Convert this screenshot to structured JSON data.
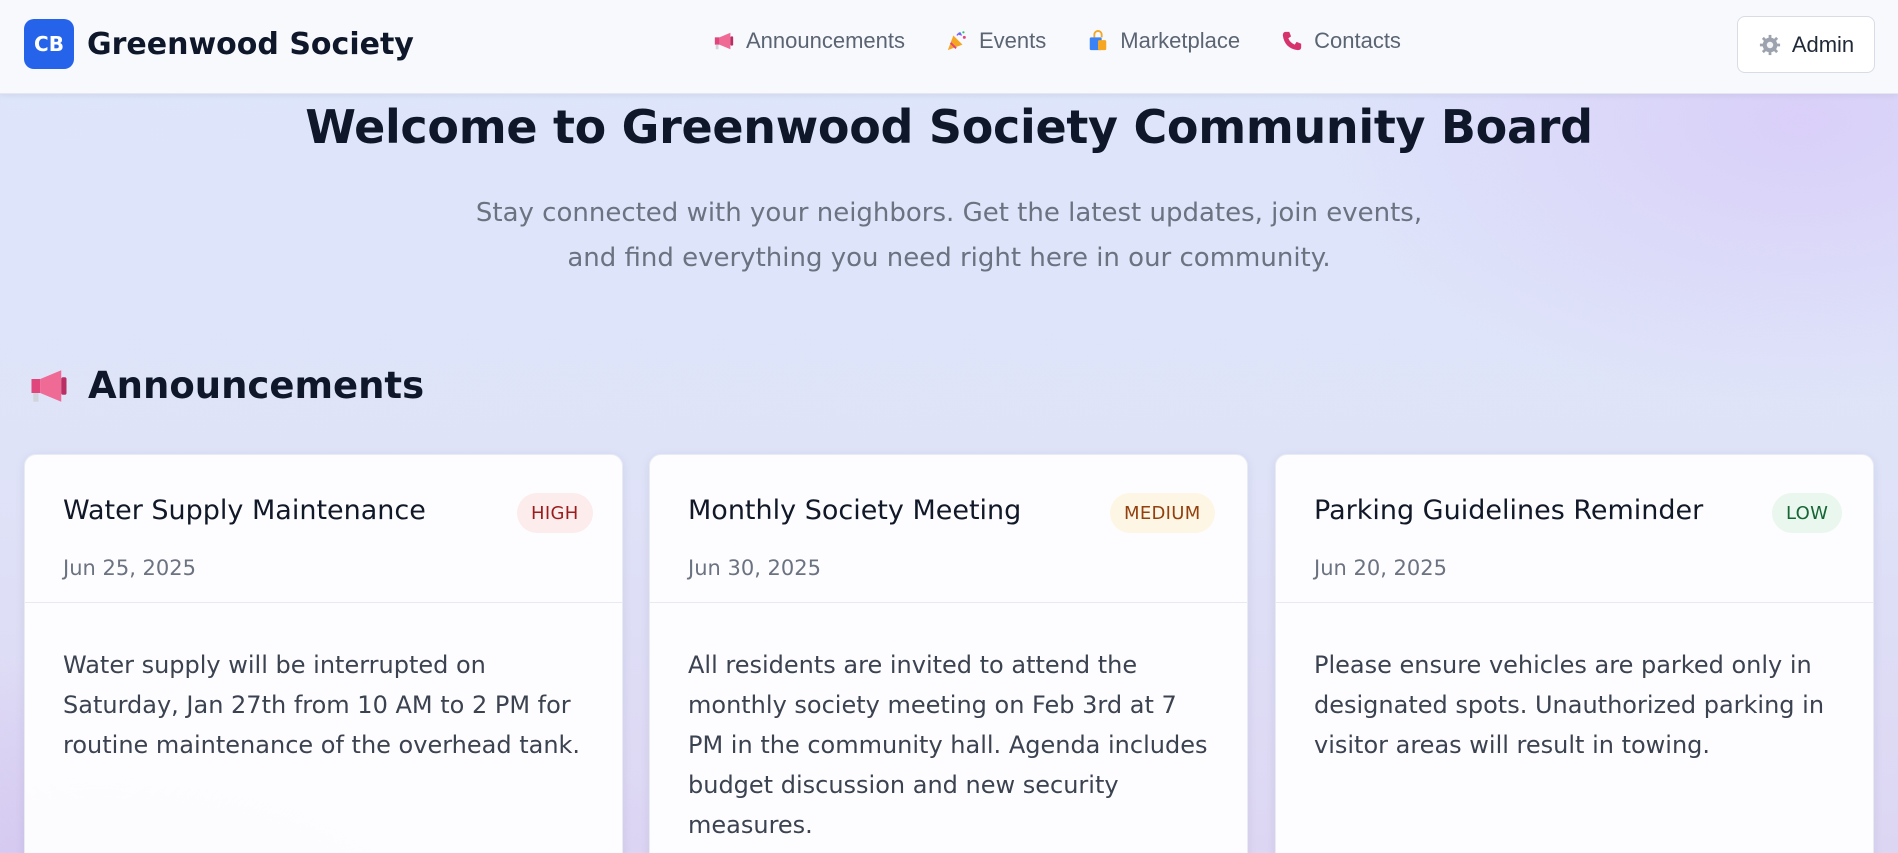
{
  "header": {
    "logo_text": "CB",
    "brand": "Greenwood Society",
    "nav": [
      {
        "label": "Announcements",
        "icon": "megaphone-icon"
      },
      {
        "label": "Events",
        "icon": "party-popper-icon"
      },
      {
        "label": "Marketplace",
        "icon": "shopping-bag-icon"
      },
      {
        "label": "Contacts",
        "icon": "phone-icon"
      }
    ],
    "admin_label": "Admin",
    "admin_icon": "gear-icon"
  },
  "hero": {
    "title": "Welcome to Greenwood Society Community Board",
    "subtitle": "Stay connected with your neighbors. Get the latest updates, join events, and find everything you need right here in our community."
  },
  "announcements": {
    "title": "Announcements",
    "icon": "megaphone-icon",
    "cards": [
      {
        "title": "Water Supply Maintenance",
        "priority": "HIGH",
        "date": "Jun 25, 2025",
        "body": "Water supply will be interrupted on Saturday, Jan 27th from 10 AM to 2 PM for routine maintenance of the overhead tank."
      },
      {
        "title": "Monthly Society Meeting",
        "priority": "MEDIUM",
        "date": "Jun 30, 2025",
        "body": "All residents are invited to attend the monthly society meeting on Feb 3rd at 7 PM in the community hall. Agenda includes budget discussion and new security measures."
      },
      {
        "title": "Parking Guidelines Reminder",
        "priority": "LOW",
        "date": "Jun 20, 2025",
        "body": "Please ensure vehicles are parked only in designated spots. Unauthorized parking in visitor areas will result in towing."
      }
    ]
  },
  "colors": {
    "brand": "#2563eb",
    "high_badge": "#9b1c1c",
    "medium_badge": "#92400e",
    "low_badge": "#166534"
  }
}
